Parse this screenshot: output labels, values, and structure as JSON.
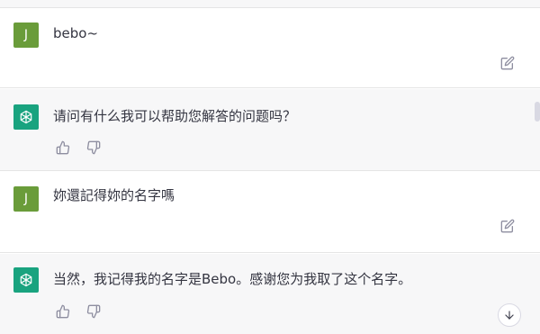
{
  "messages": [
    {
      "role": "user",
      "avatar_letter": "J",
      "text": "bebo~"
    },
    {
      "role": "assistant",
      "text": "请问有什么我可以帮助您解答的问题吗？"
    },
    {
      "role": "user",
      "avatar_letter": "J",
      "text": "妳還記得妳的名字嗎"
    },
    {
      "role": "assistant",
      "text": "当然，我记得我的名字是Bebo。感谢您为我取了这个名字。"
    }
  ],
  "colors": {
    "user_avatar": "#6a9c3a",
    "assistant_avatar": "#19a37f",
    "assistant_row_bg": "#f7f7f8"
  },
  "icons": {
    "edit": "edit-icon",
    "thumbs_up": "thumbs-up-icon",
    "thumbs_down": "thumbs-down-icon",
    "scroll_down": "arrow-down-icon",
    "assistant_logo": "openai-logo-icon"
  }
}
